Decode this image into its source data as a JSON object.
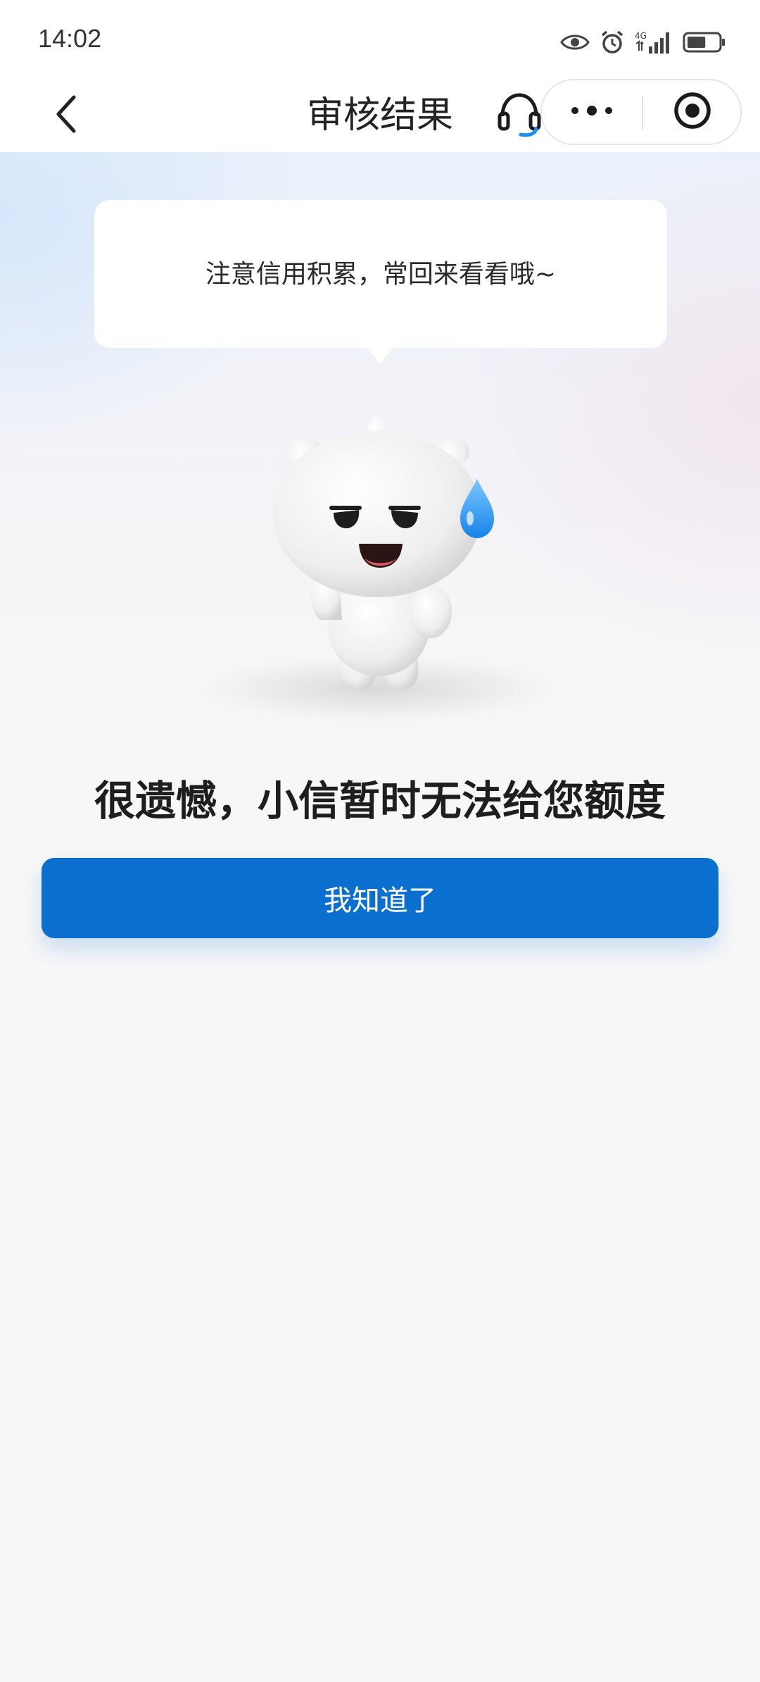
{
  "status_bar": {
    "time": "14:02",
    "network_label": "4G",
    "battery_level": 0.6
  },
  "nav": {
    "title": "审核结果",
    "back_icon": "chevron-left-icon",
    "support_icon": "headset-icon",
    "more_icon": "more-dots-icon",
    "close_icon": "target-close-icon"
  },
  "bubble": {
    "text": "注意信用积累，常回来看看哦~"
  },
  "result": {
    "title": "很遗憾，小信暂时无法给您额度",
    "confirm_label": "我知道了"
  },
  "colors": {
    "primary": "#0b6fd0",
    "title_text": "#1e1e1e",
    "tear_drop": "#2a9bf0"
  }
}
